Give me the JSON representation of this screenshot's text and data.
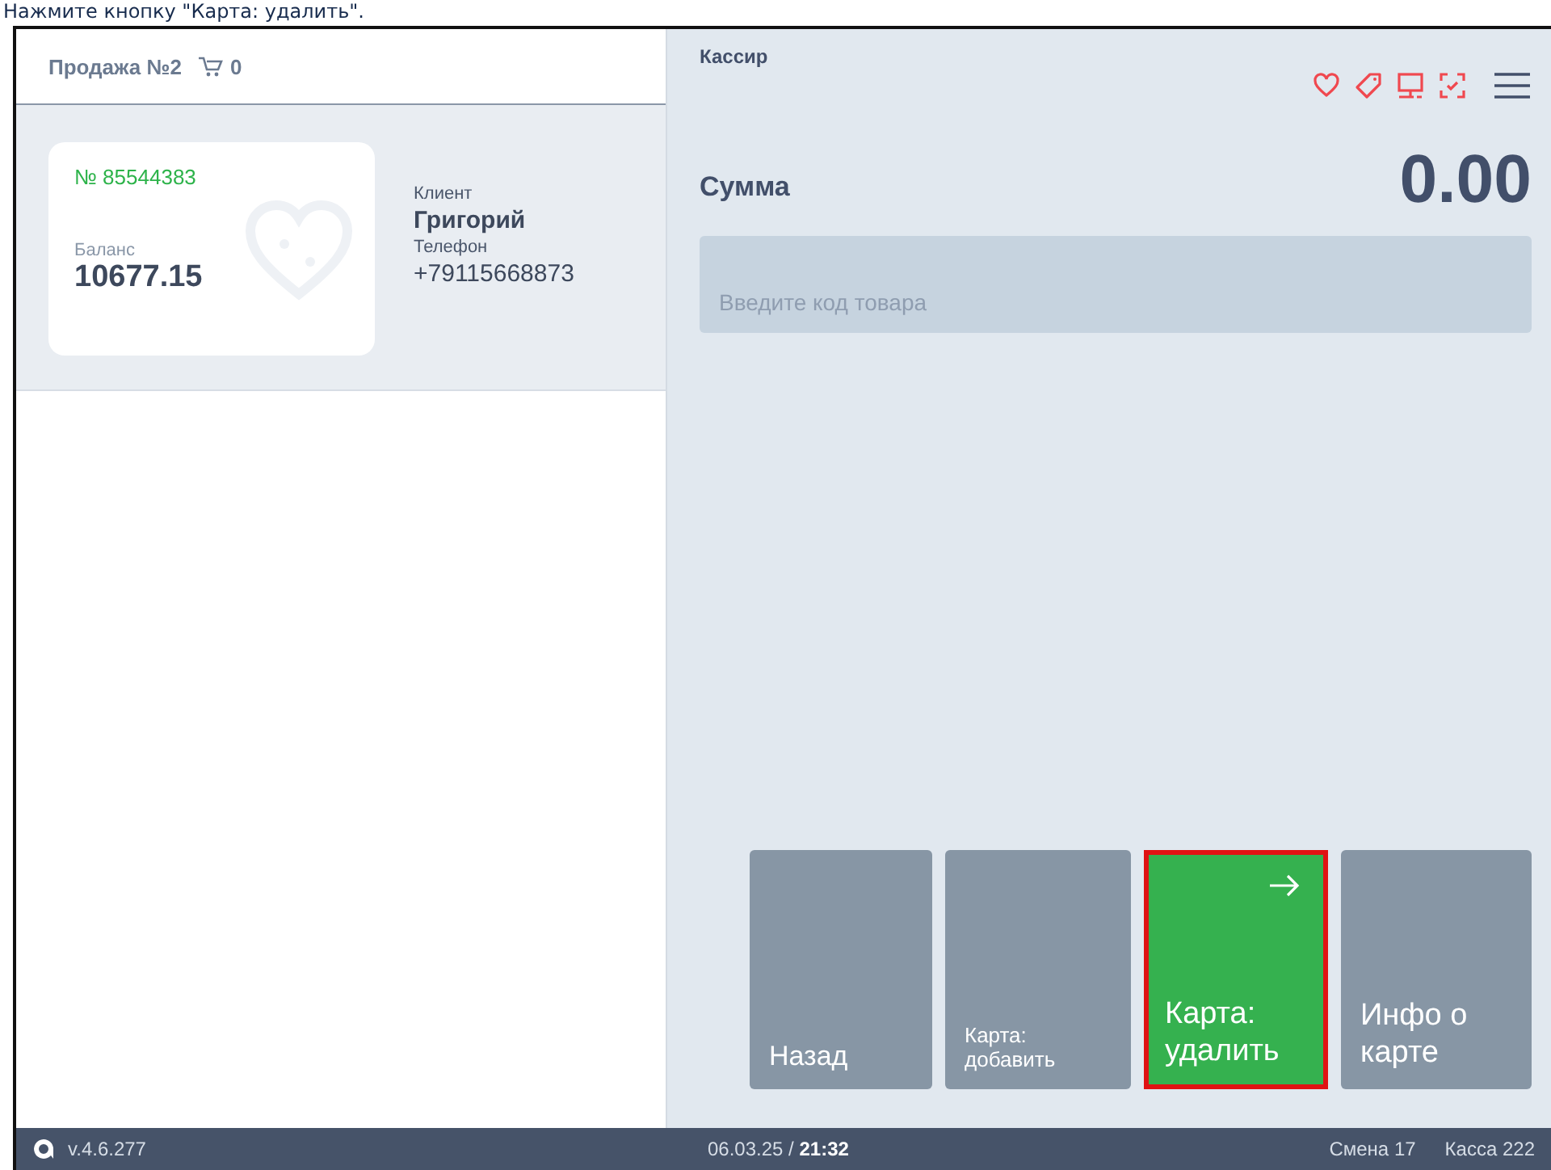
{
  "caption": "Нажмите кнопку \"Карта: удалить\".",
  "sale": {
    "title": "Продажа №2",
    "cart_count": "0"
  },
  "card": {
    "number": "№ 85544383",
    "balance_label": "Баланс",
    "balance": "10677.15"
  },
  "client": {
    "client_label": "Клиент",
    "name": "Григорий",
    "phone_label": "Телефон",
    "phone": "+79115668873"
  },
  "cashier": "Кассир",
  "total": {
    "label": "Сумма",
    "value": "0.00"
  },
  "code_field": {
    "placeholder": "Введите код товара"
  },
  "buttons": [
    {
      "label": "Назад",
      "kind": "medium",
      "selected": false
    },
    {
      "label": "Карта: добавить",
      "kind": "small",
      "selected": false
    },
    {
      "label": "Карта: удалить",
      "kind": "large",
      "selected": true
    },
    {
      "label": "Инфо о карте",
      "kind": "large",
      "selected": false
    }
  ],
  "status_bar": {
    "version": "v.4.6.277",
    "datetime": "06.03.25 / **21:32**",
    "shift": "Смена 17",
    "register": "Касса 222"
  }
}
